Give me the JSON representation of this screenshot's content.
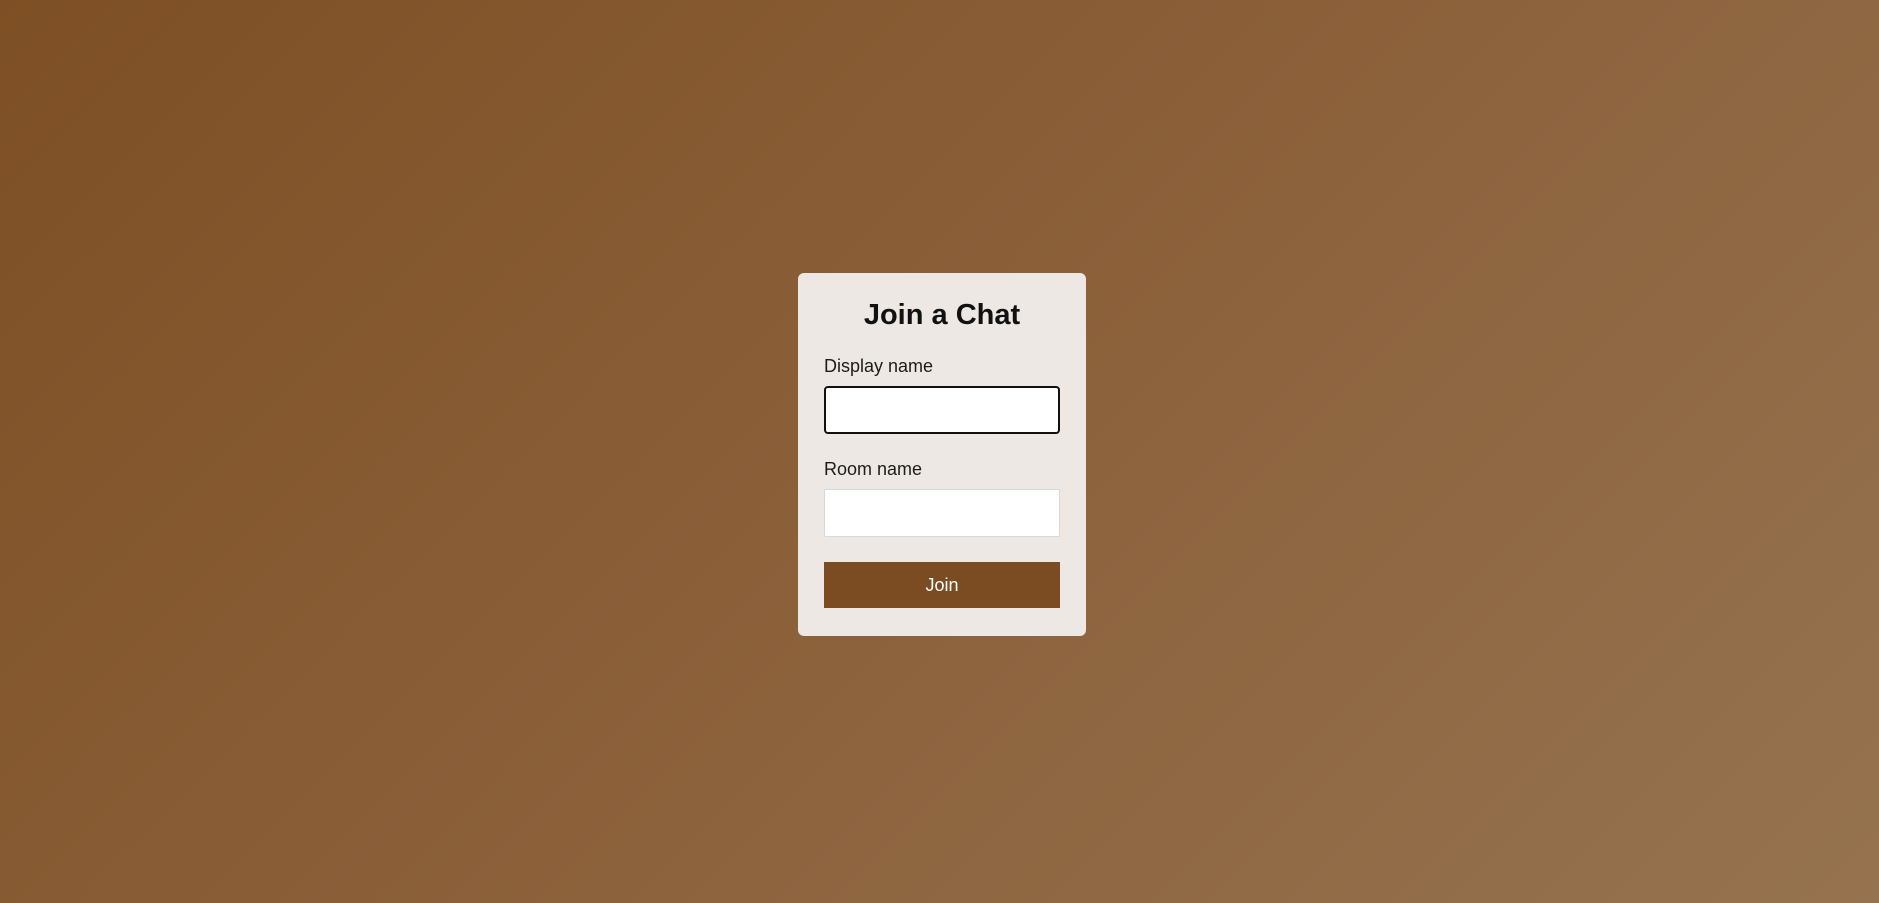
{
  "join_form": {
    "title": "Join a Chat",
    "display_name_label": "Display name",
    "display_name_value": "",
    "room_name_label": "Room name",
    "room_name_value": "",
    "join_label": "Join"
  },
  "colors": {
    "background_start": "#7e4f24",
    "background_end": "#967350",
    "card_background": "#ede8e3",
    "button_background": "#7b4c22",
    "button_text": "#ffffff"
  }
}
